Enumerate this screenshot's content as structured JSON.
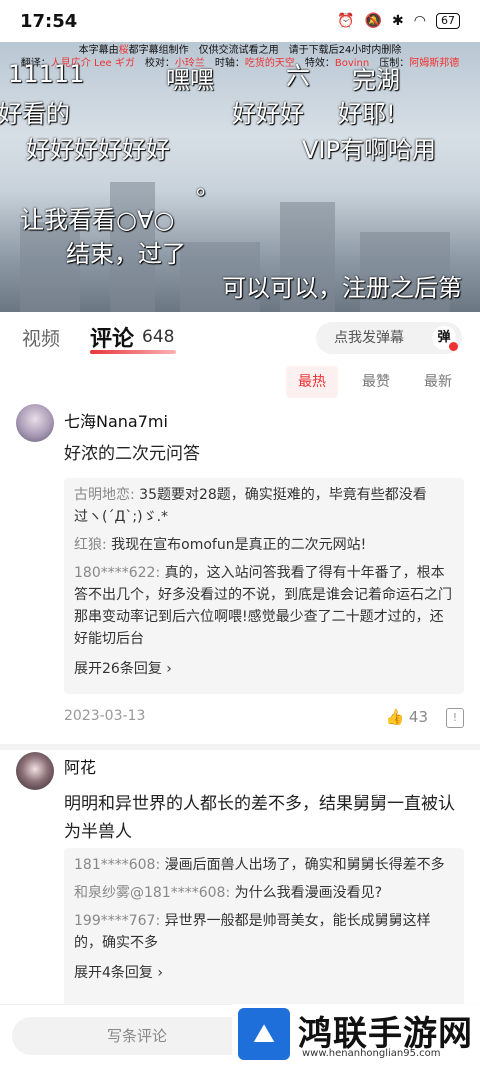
{
  "status_bar": {
    "time": "17:54",
    "battery": "67"
  },
  "video": {
    "subtitle_line1_a": "本字幕由",
    "subtitle_line1_red": "桜",
    "subtitle_line1_b": "都字幕组制作　仅供交流试看之用　请于下载后24小时内删除",
    "subtitle_line2_a": "翻译：",
    "subtitle_line2_red1": "人見広介 Lee ギガ",
    "subtitle_line2_b": "　校对：",
    "subtitle_line2_red2": "小玲兰",
    "subtitle_line2_c": "　时轴：",
    "subtitle_line2_red3": "吃货的天空",
    "subtitle_line2_d": "　特效：",
    "subtitle_line2_red4": "Bovinn",
    "subtitle_line2_e": "　压制：",
    "subtitle_line2_red5": "阿姆斯邦德",
    "danmaku": [
      "11111",
      "嘿嘿",
      "六",
      "完湖",
      "好看的",
      "好好好",
      "好耶!",
      "好好好好好好",
      "VIP有啊哈用",
      "。",
      "让我看看○∀○",
      "结束，过了",
      "可以可以，注册之后第"
    ]
  },
  "tabs": {
    "video": "视频",
    "comments": "评论",
    "comment_count": "648"
  },
  "danmaku_input": {
    "placeholder": "点我发弹幕",
    "badge": "弹"
  },
  "sort": {
    "hot": "最热",
    "likes": "最赞",
    "newest": "最新"
  },
  "comments": [
    {
      "user": "七海Nana7mi",
      "text": "好浓的二次元问答",
      "replies": [
        {
          "who": "古明地恋:",
          "text": " 35题要对28题，确实挺难的，毕竟有些都没看过ヽ(´Д`;)ゞ.*"
        },
        {
          "who": "红狼:",
          "text": " 我现在宣布omofun是真正的二次元网站!"
        },
        {
          "who": "180****622:",
          "text": " 真的，这入站问答我看了得有十年番了，根本答不出几个，好多没看过的不说，到底是谁会记着命运石之门那串变动率记到后六位啊喂!感觉最少查了二十题才过的，还好能切后台"
        }
      ],
      "expand": "展开26条回复 ›",
      "date": "2023-03-13",
      "likes": "43"
    },
    {
      "user": "阿花",
      "text": "明明和异世界的人都长的差不多，结果舅舅一直被认为半兽人",
      "replies": [
        {
          "who": "181****608:",
          "text": " 漫画后面兽人出场了，确实和舅舅长得差不多"
        },
        {
          "who": "和泉纱雾@181****608:",
          "text": " 为什么我看漫画没看见?"
        },
        {
          "who": "199****767:",
          "text": " 异世界一般都是帅哥美女，能长成舅舅这样的，确实不多"
        }
      ],
      "expand": "展开4条回复 ›"
    }
  ],
  "bottom": {
    "write_placeholder": "写条评论"
  },
  "watermark": {
    "logo": "⛰",
    "title": "鸿联手游网",
    "url": "www.henanhonglian95.com"
  }
}
